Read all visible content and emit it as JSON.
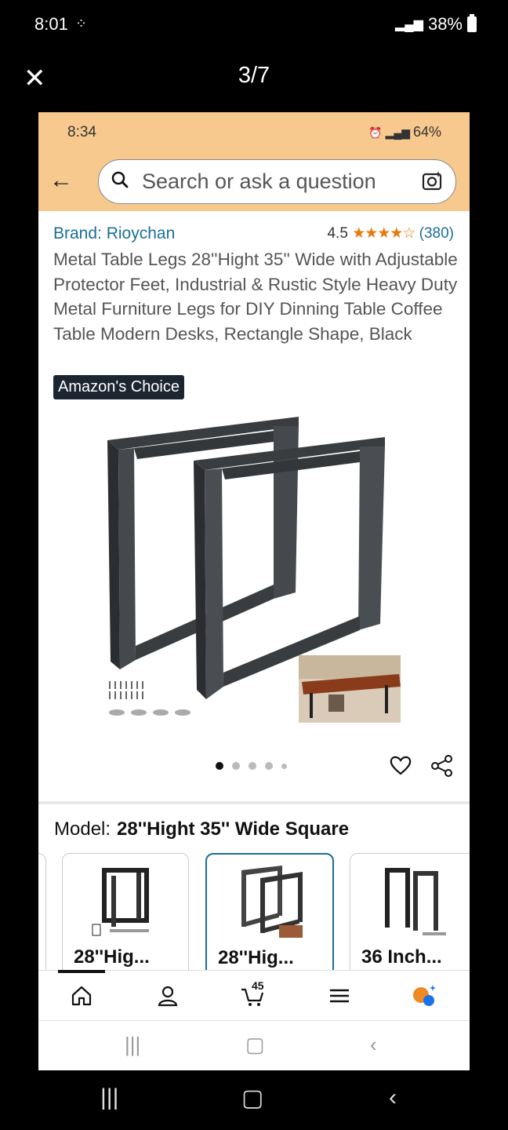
{
  "device_status": {
    "time": "8:01",
    "battery": "38%"
  },
  "viewer": {
    "close_icon": "close-icon",
    "counter": "3/7"
  },
  "screenshot": {
    "status_time": "8:34",
    "status_battery": "64%",
    "search_placeholder": "Search or ask a question",
    "brand": "Brand: Rioychan",
    "rating_value": "4.5",
    "rating_stars": "★★★★☆",
    "rating_count": "(380)",
    "title": "Metal Table Legs 28''Hight 35'' Wide with Adjustable Protector Feet, Industrial & Rustic Style Heavy Duty Metal Furniture Legs for DIY Dinning Table Coffee Table Modern Desks, Rectangle Shape, Black",
    "badge": "Amazon's Choice",
    "image_dots": 5,
    "active_dot": 1,
    "model_label": "Model:",
    "model_value": "28''Hight 35'' Wide Square",
    "variants": [
      {
        "label": "28''Hig...",
        "selected": false
      },
      {
        "label": "28''Hig...",
        "selected": true
      },
      {
        "label": "36 Inch...",
        "selected": false
      }
    ],
    "cart_count": "45"
  },
  "colors": {
    "header_bg": "#f7c98e",
    "link": "#1a6f98",
    "star": "#e87a0c",
    "badge_bg": "#1c2631"
  }
}
